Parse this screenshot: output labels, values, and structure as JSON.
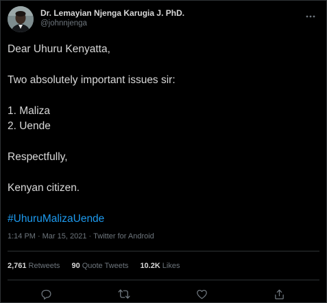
{
  "author": {
    "display_name": "Dr. Lemayian Njenga Karugia J. PhD.",
    "handle": "@johnnjenga"
  },
  "tweet": {
    "lines": [
      "Dear Uhuru Kenyatta,",
      "Two absolutely important issues sir:",
      "1. Maliza",
      "2. Uende",
      "Respectfully,",
      "Kenyan citizen."
    ],
    "hashtag": "#UhuruMalizaUende"
  },
  "meta": {
    "time": "1:14 PM",
    "separator": "·",
    "date": "Mar 15, 2021",
    "source": "Twitter for Android"
  },
  "stats": {
    "retweets_count": "2,761",
    "retweets_label": "Retweets",
    "quotes_count": "90",
    "quotes_label": "Quote Tweets",
    "likes_count": "10.2K",
    "likes_label": "Likes"
  },
  "icons": {
    "more": "more-icon",
    "reply": "reply-icon",
    "retweet": "retweet-icon",
    "like": "like-icon",
    "share": "share-icon"
  },
  "colors": {
    "background": "#000000",
    "text": "#d9d9d9",
    "secondary": "#6e767d",
    "link": "#1d9bf0",
    "border": "#2f3336"
  }
}
